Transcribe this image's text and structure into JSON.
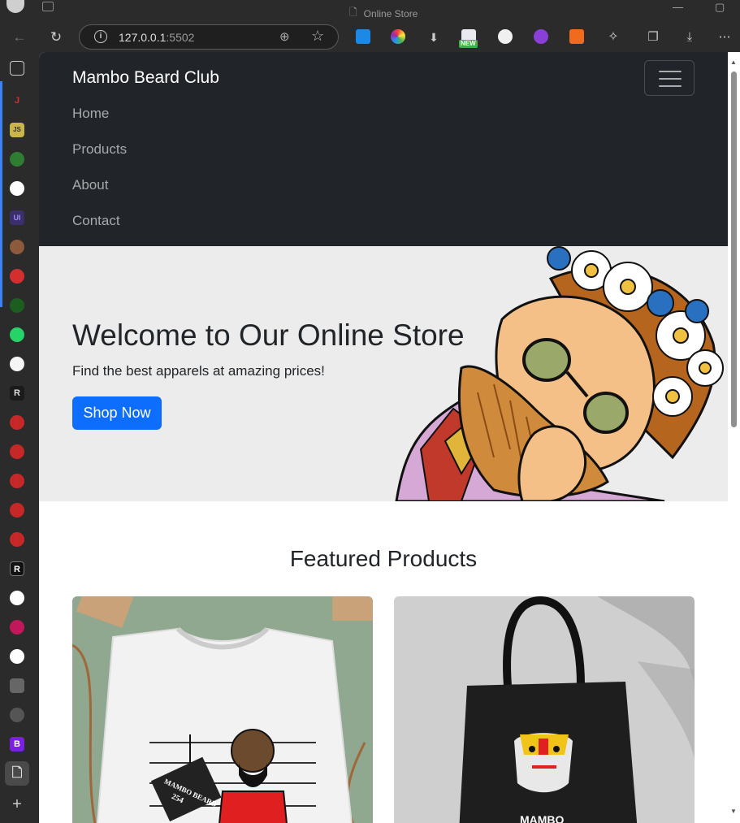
{
  "browser": {
    "tab_title": "Online Store",
    "url_host": "127.0.0.1",
    "url_port": ":5502"
  },
  "extensions": {
    "new_badge": "NEW"
  },
  "navbar": {
    "brand": "Mambo Beard Club",
    "links": [
      "Home",
      "Products",
      "About",
      "Contact"
    ]
  },
  "hero": {
    "heading": "Welcome to Our Online Store",
    "subheading": "Find the best apparels at amazing prices!",
    "cta": "Shop Now"
  },
  "featured": {
    "heading": "Featured Products",
    "products": [
      {
        "image": "mambo-beard-tshirt",
        "tee_text": "MAMBO BEARD",
        "tee_number": "254"
      },
      {
        "image": "mambo-tote-bag",
        "bag_text": "MAMBO"
      }
    ]
  },
  "colors": {
    "navbar_bg": "#212529",
    "primary": "#0d6efd",
    "hero_bg": "#ececec"
  }
}
